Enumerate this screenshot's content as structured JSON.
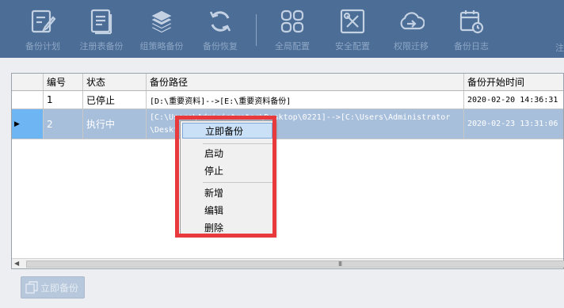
{
  "toolbar": {
    "items": [
      {
        "label": "备份计划",
        "icon": "edit-document-icon"
      },
      {
        "label": "注册表备份",
        "icon": "document-list-icon"
      },
      {
        "label": "组策略备份",
        "icon": "layers-icon"
      },
      {
        "label": "备份恢复",
        "icon": "refresh-icon"
      },
      {
        "label": "全局配置",
        "icon": "grid-squares-icon"
      },
      {
        "label": "安全配置",
        "icon": "tools-icon"
      },
      {
        "label": "权限迁移",
        "icon": "cloud-arrow-icon"
      },
      {
        "label": "备份日志",
        "icon": "calendar-clock-icon"
      }
    ],
    "edge_text": "注"
  },
  "grid": {
    "columns": [
      "编号",
      "状态",
      "备份路径",
      "备份开始时间"
    ],
    "rows": [
      {
        "id": "1",
        "status": "已停止",
        "path_line1": "[D:\\重要资料]-->[E:\\重要资料备份]",
        "path_line2": "",
        "start_time": "2020-02-20 14:36:31"
      },
      {
        "id": "2",
        "status": "执行中",
        "path_line1": "[C:\\Users\\Administrator\\Desktop\\0221]-->[C:\\Users\\Administrator",
        "path_line2": "\\Deskt",
        "start_time": "2020-02-23 13:31:06"
      }
    ],
    "selected_row_marker": "▶",
    "scroll_grip": "III",
    "scroll_left_arrow": "◀"
  },
  "context_menu": {
    "items": [
      "立即备份",
      "启动",
      "停止",
      "新增",
      "编辑",
      "删除"
    ]
  },
  "bottom": {
    "backup_now_label": "立即备份"
  },
  "colors": {
    "toolbar_bg": "#4b6d96",
    "selected_row": "#a8bfdc",
    "highlight_border": "#e8393d"
  }
}
